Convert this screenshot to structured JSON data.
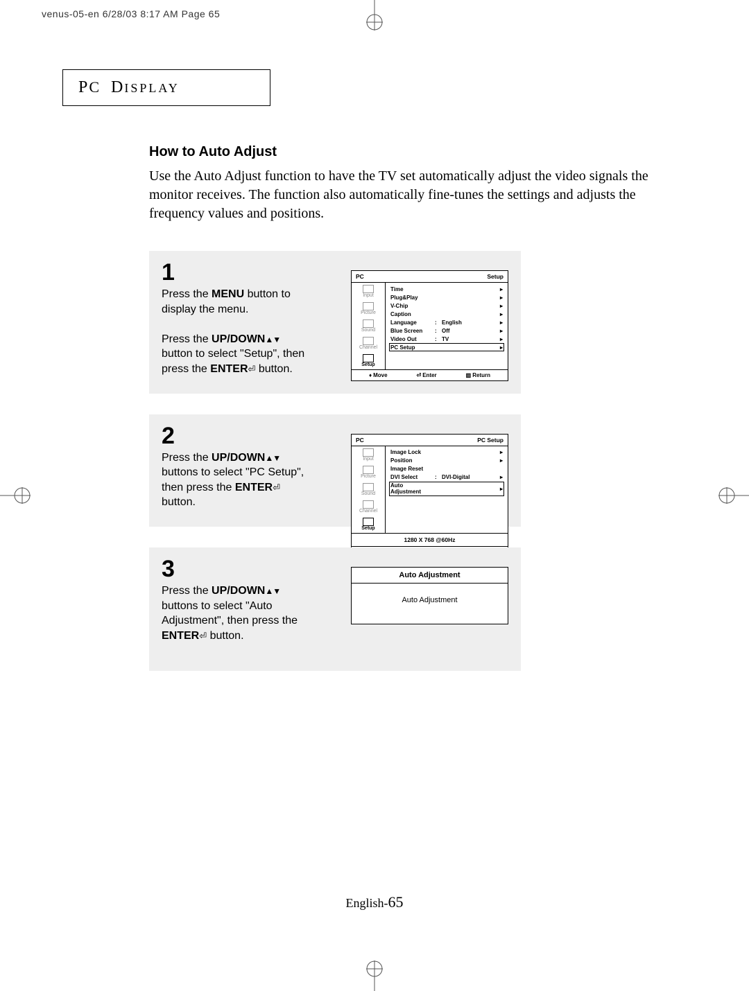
{
  "print_header": "venus-05-en  6/28/03  8:17 AM  Page 65",
  "title_box": "PC Display",
  "section_title": "How to Auto Adjust",
  "intro": "Use the Auto Adjust function to have the TV set automatically adjust the video signals the monitor receives.   The function also automatically fine-tunes the settings and adjusts the frequency values and positions.",
  "steps": {
    "s1": {
      "num": "1",
      "line1a": "Press the ",
      "line1b": "MENU",
      "line1c": " button to display the menu.",
      "line2a": "Press the ",
      "line2b": "UP/DOWN",
      "line2c": " button to select \"Setup\", then press the ",
      "line2d": "ENTER",
      "line2e": " button."
    },
    "s2": {
      "num": "2",
      "line1a": "Press the ",
      "line1b": "UP/DOWN",
      "line1c": " buttons to select \"PC Setup\", then press the ",
      "line1d": "ENTER",
      "line1e": " button."
    },
    "s3": {
      "num": "3",
      "line1a": "Press the ",
      "line1b": "UP/DOWN",
      "line1c": " buttons to select \"Auto Adjustment\", then press the ",
      "line1d": "ENTER",
      "line1e": "  button."
    }
  },
  "osd_nav": [
    "Input",
    "Picture",
    "Sound",
    "Channel",
    "Setup"
  ],
  "osd1": {
    "header_left": "PC",
    "header_right": "Setup",
    "active_nav": 4,
    "rows": [
      {
        "label": "Time",
        "value": "",
        "caret": true
      },
      {
        "label": "Plug&Play",
        "value": "",
        "caret": true
      },
      {
        "label": "V-Chip",
        "value": "",
        "caret": true
      },
      {
        "label": "Caption",
        "value": "",
        "caret": true
      },
      {
        "label": "Language",
        "value": "English",
        "colon": true,
        "caret": true
      },
      {
        "label": "Blue Screen",
        "value": "Off",
        "colon": true,
        "caret": true
      },
      {
        "label": "Video Out",
        "value": "TV",
        "colon": true,
        "caret": true
      },
      {
        "label": "PC Setup",
        "value": "",
        "caret": true,
        "selected": true
      }
    ]
  },
  "osd2": {
    "header_left": "PC",
    "header_right": "PC Setup",
    "active_nav": 4,
    "rows": [
      {
        "label": "Image Lock",
        "value": "",
        "caret": true
      },
      {
        "label": "Position",
        "value": "",
        "caret": true
      },
      {
        "label": "Image Reset",
        "value": "",
        "caret": false
      },
      {
        "label": "DVI Select",
        "value": "DVI-Digital",
        "colon": true,
        "caret": true
      },
      {
        "label": "Auto Adjustment",
        "value": "",
        "caret": true,
        "selected": true
      }
    ],
    "status": "1280 X 768 @60Hz"
  },
  "osd_footer": {
    "move": "Move",
    "enter": "Enter",
    "return": "Return"
  },
  "dialog3": {
    "title": "Auto Adjustment",
    "body": "Auto Adjustment"
  },
  "page_footer_prefix": "English-",
  "page_footer_num": "65"
}
